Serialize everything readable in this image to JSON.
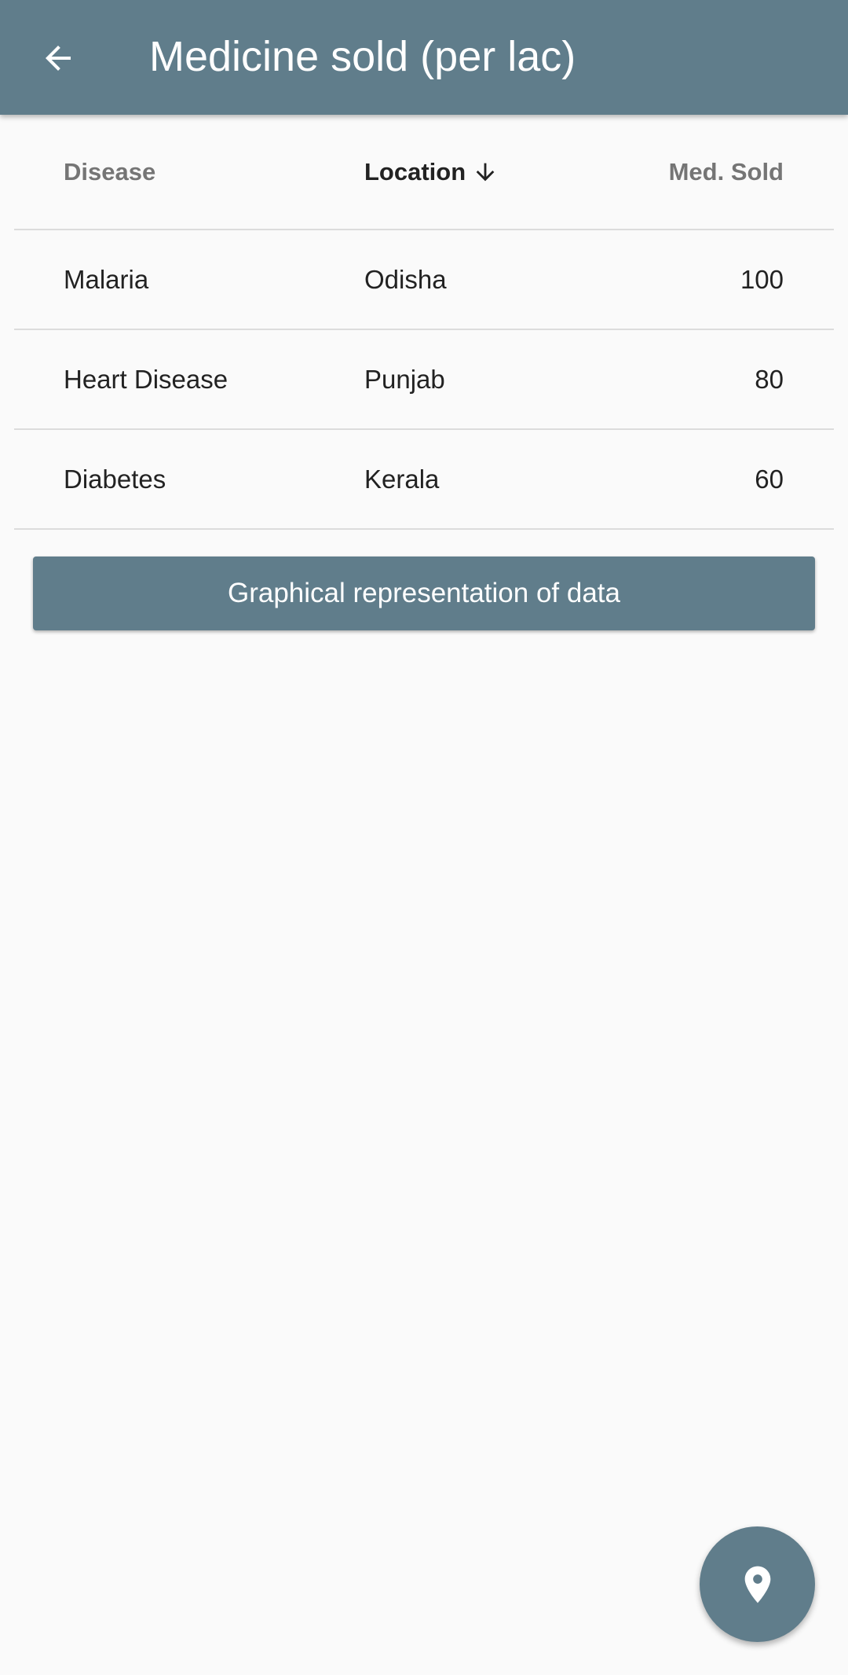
{
  "app_bar": {
    "title": "Medicine sold (per lac)",
    "back_icon": "arrow-back-icon",
    "color": "#607d8b"
  },
  "table": {
    "columns": [
      {
        "label": "Disease"
      },
      {
        "label": "Location",
        "sort_icon": "arrow-down-icon",
        "sorted": "descending"
      },
      {
        "label": "Med. Sold"
      }
    ],
    "rows": [
      {
        "disease": "Malaria",
        "location": "Odisha",
        "sold": "100"
      },
      {
        "disease": "Heart Disease",
        "location": "Punjab",
        "sold": "80"
      },
      {
        "disease": "Diabetes",
        "location": "Kerala",
        "sold": "60"
      }
    ]
  },
  "graph_button": {
    "label": "Graphical representation of data"
  },
  "fab": {
    "icon": "location-pin-icon"
  }
}
